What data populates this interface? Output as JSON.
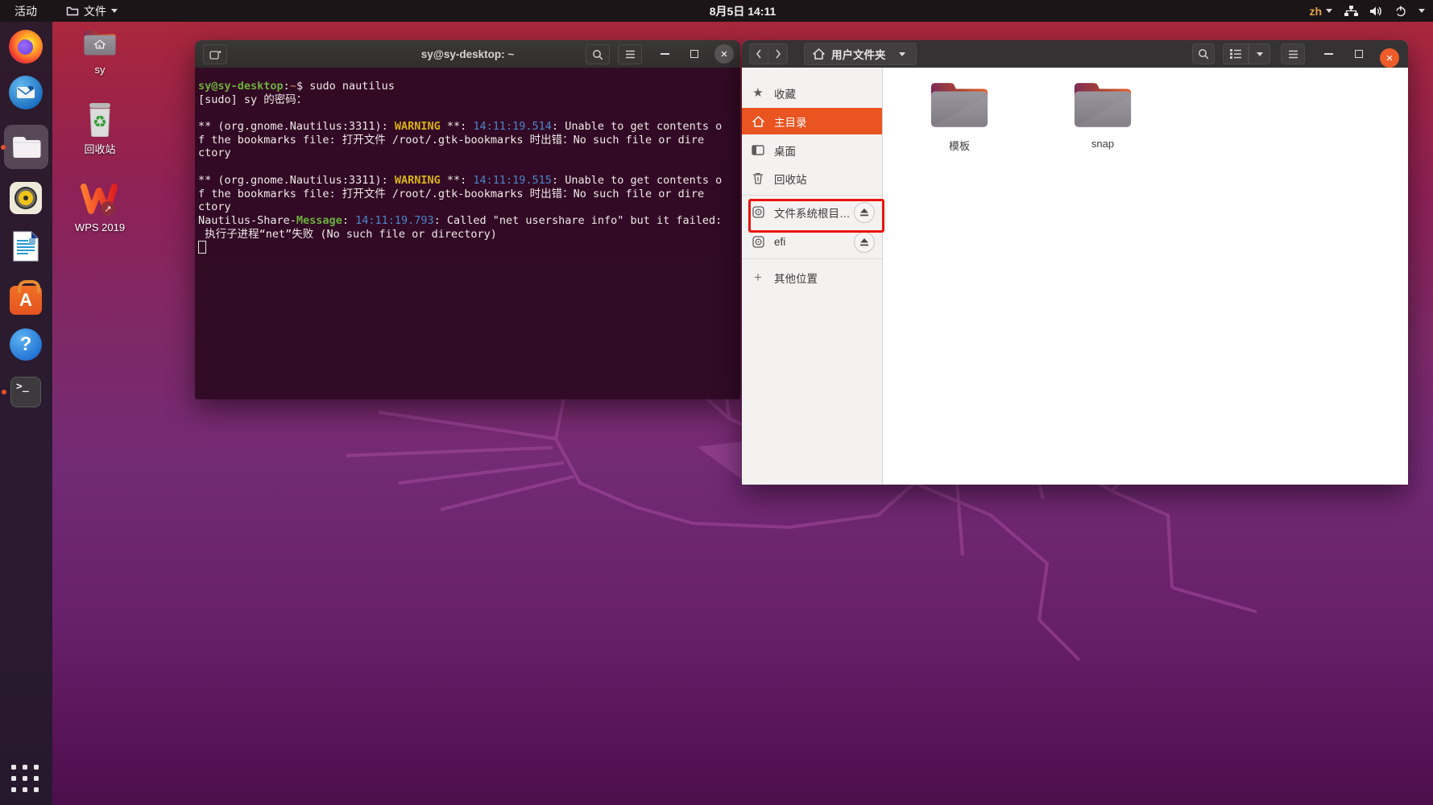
{
  "topbar": {
    "activities": "活动",
    "app_menu": "文件",
    "clock": "8月5日 14:11",
    "input_indicator": "zh"
  },
  "dock": {
    "items": [
      {
        "name": "firefox"
      },
      {
        "name": "thunderbird"
      },
      {
        "name": "files",
        "active": true,
        "running": true
      },
      {
        "name": "rhythmbox"
      },
      {
        "name": "libreoffice-writer"
      },
      {
        "name": "ubuntu-software"
      },
      {
        "name": "help"
      },
      {
        "name": "terminal",
        "running": true
      }
    ],
    "show_apps": "show-applications"
  },
  "desktop": {
    "icons": [
      {
        "label": "sy",
        "kind": "home-folder"
      },
      {
        "label": "回收站",
        "kind": "trash"
      },
      {
        "label": "WPS 2019",
        "kind": "wps-launcher"
      }
    ]
  },
  "terminal": {
    "title": "sy@sy-desktop: ~",
    "colors": {
      "green": "#6cb03d",
      "yellow": "#d9b214",
      "blue": "#4a86c8",
      "tilde": "#d08a62",
      "background": "#300a24"
    },
    "lines": [
      [
        {
          "c": "g",
          "t": "sy@sy-desktop"
        },
        {
          "c": "w",
          "t": ":"
        },
        {
          "c": "o",
          "t": "~"
        },
        {
          "c": "w",
          "t": "$ sudo nautilus"
        }
      ],
      [
        {
          "c": "w",
          "t": "[sudo] sy 的密码："
        }
      ],
      [],
      [
        {
          "c": "w",
          "t": "** (org.gnome.Nautilus:3311): "
        },
        {
          "c": "y",
          "t": "WARNING"
        },
        {
          "c": "w",
          "t": " **: "
        },
        {
          "c": "b",
          "t": "14:11:19.514"
        },
        {
          "c": "w",
          "t": ": Unable to get contents o"
        }
      ],
      [
        {
          "c": "w",
          "t": "f the bookmarks file: 打开文件 /root/.gtk-bookmarks 时出错：No such file or dire"
        }
      ],
      [
        {
          "c": "w",
          "t": "ctory"
        }
      ],
      [],
      [
        {
          "c": "w",
          "t": "** (org.gnome.Nautilus:3311): "
        },
        {
          "c": "y",
          "t": "WARNING"
        },
        {
          "c": "w",
          "t": " **: "
        },
        {
          "c": "b",
          "t": "14:11:19.515"
        },
        {
          "c": "w",
          "t": ": Unable to get contents o"
        }
      ],
      [
        {
          "c": "w",
          "t": "f the bookmarks file: 打开文件 /root/.gtk-bookmarks 时出错：No such file or dire"
        }
      ],
      [
        {
          "c": "w",
          "t": "ctory"
        }
      ],
      [
        {
          "c": "w",
          "t": "Nautilus-Share-"
        },
        {
          "c": "g",
          "t": "Message"
        },
        {
          "c": "w",
          "t": ": "
        },
        {
          "c": "b",
          "t": "14:11:19.793"
        },
        {
          "c": "w",
          "t": ": Called \"net usershare info\" but it failed: "
        }
      ],
      [
        {
          "c": "w",
          "t": " 执行子进程“net”失败 (No such file or directory)"
        }
      ],
      [
        {
          "cursor": true
        }
      ]
    ]
  },
  "files_window": {
    "path_button": "用户文件夹",
    "sidebar": [
      {
        "label": "收藏",
        "icon": "star"
      },
      {
        "label": "主目录",
        "icon": "home",
        "selected": true
      },
      {
        "label": "桌面",
        "icon": "desktop"
      },
      {
        "label": "回收站",
        "icon": "trash",
        "sep_after": true
      },
      {
        "label": "文件系统根目…",
        "icon": "drive",
        "eject": true,
        "annotated": true
      },
      {
        "label": "efi",
        "icon": "drive",
        "eject": true,
        "sep_after": true
      },
      {
        "label": "其他位置",
        "icon": "plus"
      }
    ],
    "folders": [
      {
        "label": "模板"
      },
      {
        "label": "snap"
      }
    ],
    "annotation_color": "#e8140c",
    "accent_color": "#e95420"
  }
}
